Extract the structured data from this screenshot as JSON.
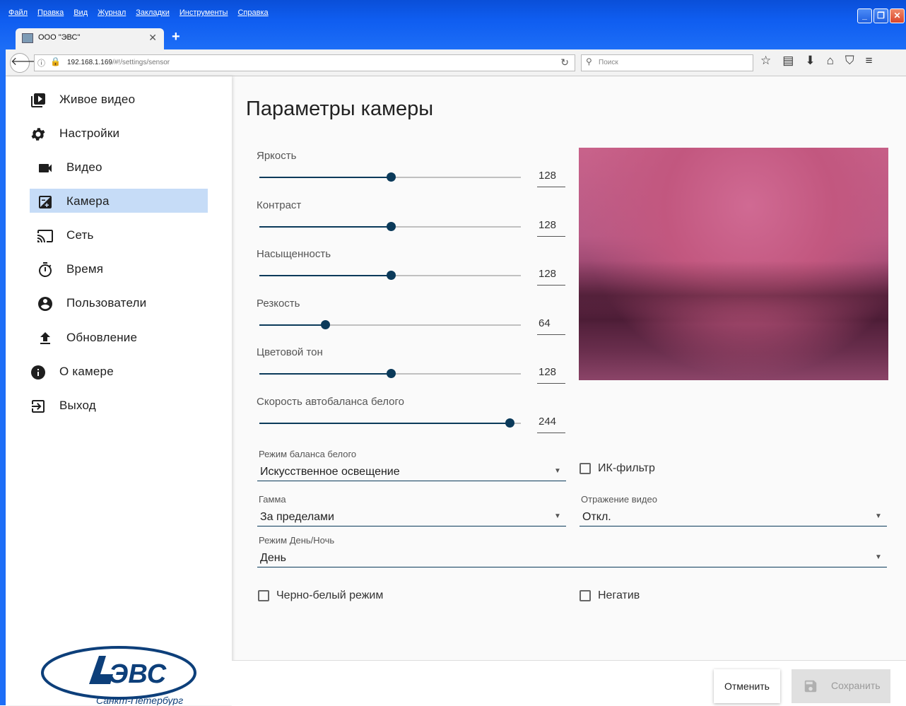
{
  "browser": {
    "menu": [
      "Файл",
      "Правка",
      "Вид",
      "Журнал",
      "Закладки",
      "Инструменты",
      "Справка"
    ],
    "tab_title": "ООО \"ЭВС\"",
    "url_host": "192.168.1.169",
    "url_path": "/#!/settings/sensor",
    "search_placeholder": "Поиск"
  },
  "sidebar": {
    "items": [
      {
        "label": "Живое видео",
        "icon": "live-video-icon"
      },
      {
        "label": "Настройки",
        "icon": "gear-icon"
      },
      {
        "label": "Видео",
        "icon": "videocam-icon"
      },
      {
        "label": "Камера",
        "icon": "camera-settings-icon",
        "active": true
      },
      {
        "label": "Сеть",
        "icon": "cast-network-icon"
      },
      {
        "label": "Время",
        "icon": "timer-icon"
      },
      {
        "label": "Пользователи",
        "icon": "account-icon"
      },
      {
        "label": "Обновление",
        "icon": "upload-icon"
      },
      {
        "label": "О камере",
        "icon": "info-icon"
      },
      {
        "label": "Выход",
        "icon": "exit-icon"
      }
    ],
    "logo_text": "ЭВС",
    "logo_subtitle": "Санкт-Петербург"
  },
  "main": {
    "title": "Параметры камеры",
    "sliders": [
      {
        "label": "Яркость",
        "value": "128",
        "fraction": 0.502
      },
      {
        "label": "Контраст",
        "value": "128",
        "fraction": 0.502
      },
      {
        "label": "Насыщенность",
        "value": "128",
        "fraction": 0.502
      },
      {
        "label": "Резкость",
        "value": "64",
        "fraction": 0.251
      },
      {
        "label": "Цветовой тон",
        "value": "128",
        "fraction": 0.502
      },
      {
        "label": "Скорость автобаланса белого",
        "value": "244",
        "fraction": 0.957
      }
    ],
    "wb_mode": {
      "label": "Режим баланса белого",
      "value": "Искусственное освещение"
    },
    "ir_filter": {
      "label": "ИК-фильтр",
      "checked": false
    },
    "gamma": {
      "label": "Гамма",
      "value": "За пределами"
    },
    "mirror": {
      "label": "Отражение видео",
      "value": "Откл."
    },
    "daynight": {
      "label": "Режим День/Ночь",
      "value": "День"
    },
    "bw_mode": {
      "label": "Черно-белый режим",
      "checked": false
    },
    "negative": {
      "label": "Негатив",
      "checked": false
    }
  },
  "footer": {
    "cancel_label": "Отменить",
    "save_label": "Сохранить"
  }
}
